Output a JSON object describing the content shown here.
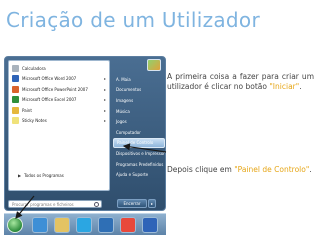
{
  "slide": {
    "title": "Criação de um Utilizador"
  },
  "start_menu": {
    "programs": [
      {
        "label": "Calculadora",
        "icon": "calculator-icon",
        "color": "#a9b3bd"
      },
      {
        "label": "Microsoft Office Word 2007",
        "icon": "word-icon",
        "color": "#2f64b8",
        "submenu": true
      },
      {
        "label": "Microsoft Office PowerPoint 2007",
        "icon": "powerpoint-icon",
        "color": "#d9622b",
        "submenu": true
      },
      {
        "label": "Microsoft Office Excel 2007",
        "icon": "excel-icon",
        "color": "#2f8f3a",
        "submenu": true
      },
      {
        "label": "Paint",
        "icon": "paint-icon",
        "color": "#e5b73b",
        "submenu": true
      },
      {
        "label": "Sticky Notes",
        "icon": "sticky-notes-icon",
        "color": "#f0e27a",
        "submenu": true
      }
    ],
    "all_programs_label": "Todos os Programas",
    "search_placeholder": "Procurar programas e ficheiros",
    "places": [
      {
        "label": "A. Maia"
      },
      {
        "label": "Documentos"
      },
      {
        "label": "Imagens"
      },
      {
        "label": "Música"
      },
      {
        "label": "Jogos"
      },
      {
        "label": "Computador"
      },
      {
        "label": "Painel de Controlo",
        "selected": true
      },
      {
        "label": "Dispositivos e Impressoras"
      },
      {
        "label": "Programas Predefinidos"
      },
      {
        "label": "Ajuda e Suporte"
      }
    ],
    "shutdown_label": "Encerrar"
  },
  "taskbar": {
    "icons": [
      {
        "name": "internet-explorer-icon",
        "color": "#3d8fd6"
      },
      {
        "name": "windows-explorer-icon",
        "color": "#e3c363"
      },
      {
        "name": "skype-icon",
        "color": "#2ba6e2"
      },
      {
        "name": "media-player-icon",
        "color": "#2f6fb5"
      },
      {
        "name": "chrome-icon",
        "color": "#e8493c"
      },
      {
        "name": "word-icon",
        "color": "#2f64b8"
      }
    ]
  },
  "instructions": {
    "step1_text": "A primeira coisa a fazer para criar um utilizador é clicar no botão ",
    "step1_highlight": "\"Iniciar\"",
    "step1_end": ".",
    "step2_text": "Depois clique em ",
    "step2_highlight": "\"Painel de Controlo\"",
    "step2_end": "."
  },
  "colors": {
    "title": "#7fb4e0",
    "highlight": "#e6a617",
    "body_text": "#444444",
    "arrow": "#1a1a1a"
  }
}
